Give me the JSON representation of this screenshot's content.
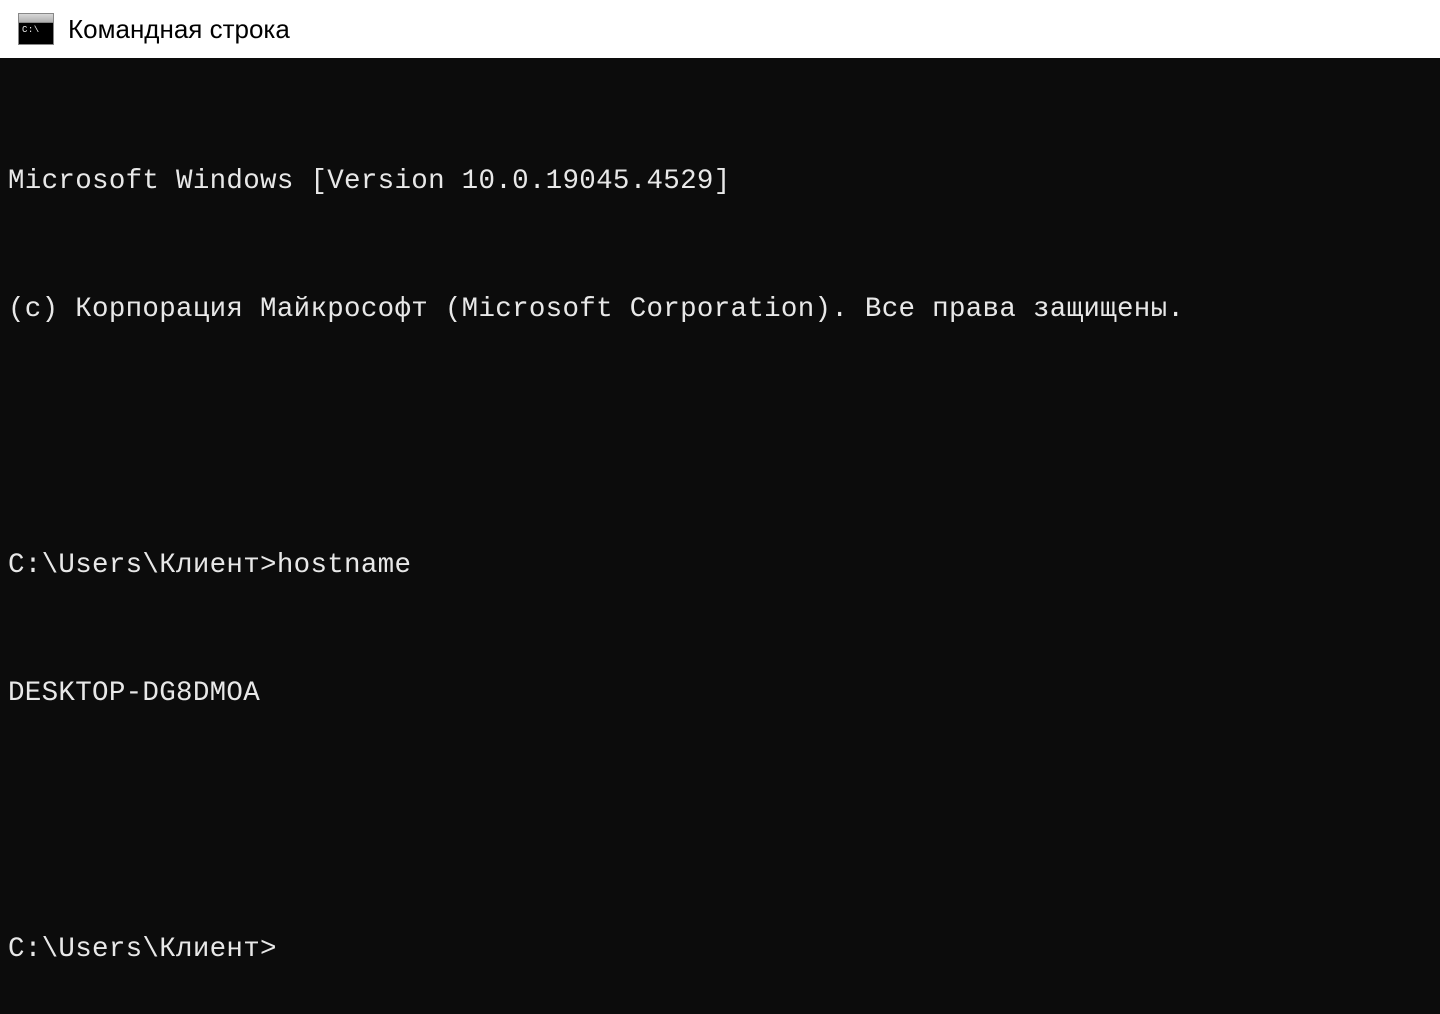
{
  "window": {
    "title": "Командная строка",
    "icon_glyph": "C:\\"
  },
  "terminal": {
    "banner_line1": "Microsoft Windows [Version 10.0.19045.4529]",
    "banner_line2": "(c) Корпорация Майкрософт (Microsoft Corporation). Все права защищены.",
    "prompt1": "C:\\Users\\Клиент>",
    "command1": "hostname",
    "output1": "DESKTOP-DG8DMOA",
    "prompt2": "C:\\Users\\Клиент>"
  }
}
